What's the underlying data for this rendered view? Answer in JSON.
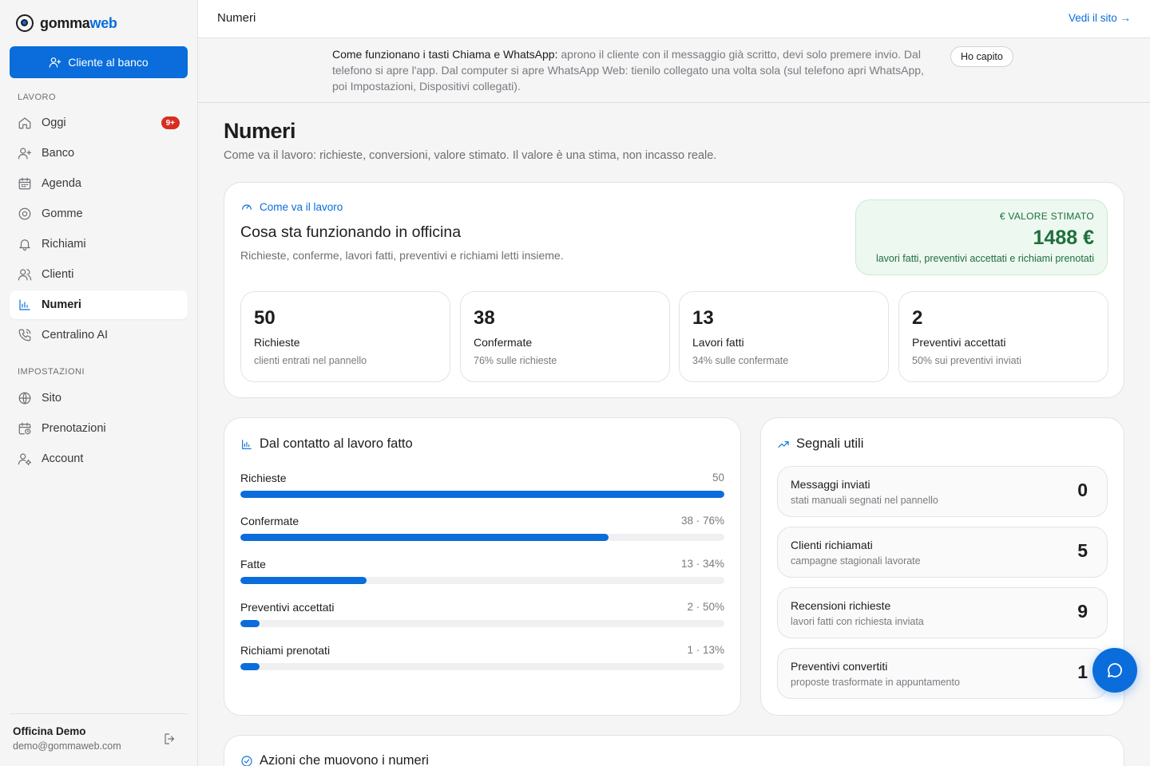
{
  "brand": {
    "part1": "gomma",
    "part2": "web"
  },
  "sidebar": {
    "cta_label": "Cliente al banco",
    "section_work": "LAVORO",
    "section_settings": "IMPOSTAZIONI",
    "work_items": [
      {
        "label": "Oggi",
        "icon": "home-icon",
        "badge": "9+"
      },
      {
        "label": "Banco",
        "icon": "user-plus-icon"
      },
      {
        "label": "Agenda",
        "icon": "calendar-icon"
      },
      {
        "label": "Gomme",
        "icon": "tire-icon"
      },
      {
        "label": "Richiami",
        "icon": "bell-icon"
      },
      {
        "label": "Clienti",
        "icon": "users-icon"
      },
      {
        "label": "Numeri",
        "icon": "chart-icon",
        "active": true
      },
      {
        "label": "Centralino AI",
        "icon": "phone-icon"
      }
    ],
    "settings_items": [
      {
        "label": "Sito",
        "icon": "globe-icon"
      },
      {
        "label": "Prenotazioni",
        "icon": "calendar-clock-icon"
      },
      {
        "label": "Account",
        "icon": "user-gear-icon"
      }
    ],
    "footer": {
      "name": "Officina Demo",
      "email": "demo@gommaweb.com"
    }
  },
  "topbar": {
    "title": "Numeri",
    "link": "Vedi il sito →"
  },
  "banner": {
    "bold": "Come funzionano i tasti Chiama e WhatsApp:",
    "text": " aprono il cliente con il messaggio già scritto, devi solo premere invio. Dal telefono si apre l'app. Dal computer si apre WhatsApp Web: tienilo collegato una volta sola (sul telefono apri WhatsApp, poi Impostazioni, Dispositivi collegati).",
    "button": "Ho capito"
  },
  "page": {
    "title": "Numeri",
    "subtitle": "Come va il lavoro: richieste, conversioni, valore stimato. Il valore è una stima, non incasso reale."
  },
  "overview": {
    "eyebrow": "Come va il lavoro",
    "title": "Cosa sta funzionando in officina",
    "subtitle": "Richieste, conferme, lavori fatti, preventivi e richiami letti insieme.",
    "value": {
      "label": "€  VALORE STIMATO",
      "amount": "1488 €",
      "note": "lavori fatti, preventivi accettati e richiami prenotati",
      "color": "#1e6f3c"
    },
    "stats": [
      {
        "num": "50",
        "label": "Richieste",
        "note": "clienti entrati nel pannello"
      },
      {
        "num": "38",
        "label": "Confermate",
        "note": "76% sulle richieste"
      },
      {
        "num": "13",
        "label": "Lavori fatti",
        "note": "34% sulle confermate"
      },
      {
        "num": "2",
        "label": "Preventivi accettati",
        "note": "50% sui preventivi inviati"
      }
    ]
  },
  "funnel": {
    "title": "Dal contatto al lavoro fatto",
    "rows": [
      {
        "label": "Richieste",
        "value": "50",
        "fill": 1.0
      },
      {
        "label": "Confermate",
        "value": "38 · 76%",
        "fill": 0.76
      },
      {
        "label": "Fatte",
        "value": "13 · 34%",
        "fill": 0.26
      },
      {
        "label": "Preventivi accettati",
        "value": "2 · 50%",
        "fill": 0.04
      },
      {
        "label": "Richiami prenotati",
        "value": "1 · 13%",
        "fill": 0.04
      }
    ]
  },
  "signals": {
    "title": "Segnali utili",
    "items": [
      {
        "label": "Messaggi inviati",
        "note": "stati manuali segnati nel pannello",
        "num": "0"
      },
      {
        "label": "Clienti richiamati",
        "note": "campagne stagionali lavorate",
        "num": "5"
      },
      {
        "label": "Recensioni richieste",
        "note": "lavori fatti con richiesta inviata",
        "num": "9"
      },
      {
        "label": "Preventivi convertiti",
        "note": "proposte trasformate in appuntamento",
        "num": "1"
      }
    ]
  },
  "actions": {
    "title": "Azioni che muovono i numeri"
  },
  "colors": {
    "accent": "#0a6ddb",
    "danger": "#d92d20",
    "success": "#1e6f3c"
  }
}
